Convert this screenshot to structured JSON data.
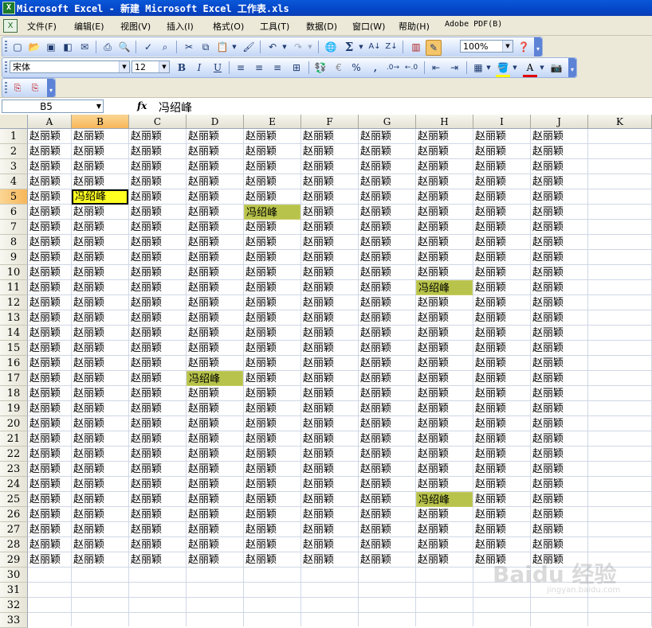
{
  "window": {
    "title": "Microsoft Excel - 新建 Microsoft Excel 工作表.xls",
    "app_icon": "excel-icon"
  },
  "menu": [
    "文件(F)",
    "编辑(E)",
    "视图(V)",
    "插入(I)",
    "格式(O)",
    "工具(T)",
    "数据(D)",
    "窗口(W)",
    "帮助(H)",
    "Adobe PDF(B)"
  ],
  "standard_toolbar": {
    "zoom": "100%",
    "sum_symbol": "Σ"
  },
  "format_toolbar": {
    "font": "宋体",
    "size": "12",
    "bold": "B",
    "italic": "I",
    "underline": "U",
    "percent": "%",
    "comma": ","
  },
  "formula_bar": {
    "name_box": "B5",
    "fx": "fx",
    "value": "冯绍峰"
  },
  "columns": [
    "A",
    "B",
    "C",
    "D",
    "E",
    "F",
    "G",
    "H",
    "I",
    "J",
    "K"
  ],
  "rows": [
    "1",
    "2",
    "3",
    "4",
    "5",
    "6",
    "7",
    "8",
    "9",
    "10",
    "11",
    "12",
    "13",
    "14",
    "15",
    "16",
    "17",
    "18",
    "19",
    "20",
    "21",
    "22",
    "23",
    "24",
    "25",
    "26",
    "27",
    "28",
    "29",
    "30",
    "31",
    "32",
    "33"
  ],
  "sheet": {
    "fill_text": "赵丽颖",
    "highlight_text": "冯绍峰",
    "filled_rows": 29,
    "filled_cols": 10,
    "highlights": [
      {
        "row": 5,
        "col": "B",
        "active": true
      },
      {
        "row": 6,
        "col": "E"
      },
      {
        "row": 11,
        "col": "H"
      },
      {
        "row": 17,
        "col": "D"
      },
      {
        "row": 25,
        "col": "H"
      }
    ],
    "highlight_color": "#b7c34a",
    "active_color": "#ffff22"
  },
  "watermark": {
    "text": "Baidu 经验",
    "sub": "jingyan.baidu.com"
  }
}
